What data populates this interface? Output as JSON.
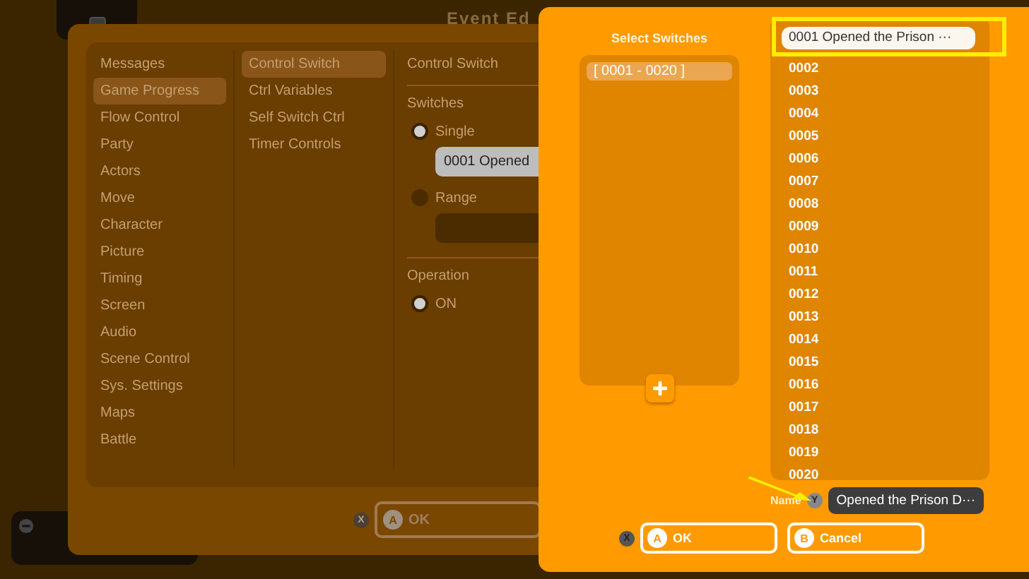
{
  "background": {
    "title": "Event Ed"
  },
  "editor": {
    "categories": [
      {
        "label": "Messages",
        "selected": false
      },
      {
        "label": "Game Progress",
        "selected": true
      },
      {
        "label": "Flow Control",
        "selected": false
      },
      {
        "label": "Party",
        "selected": false
      },
      {
        "label": "Actors",
        "selected": false
      },
      {
        "label": "Move",
        "selected": false
      },
      {
        "label": "Character",
        "selected": false
      },
      {
        "label": "Picture",
        "selected": false
      },
      {
        "label": "Timing",
        "selected": false
      },
      {
        "label": "Screen",
        "selected": false
      },
      {
        "label": "Audio",
        "selected": false
      },
      {
        "label": "Scene Control",
        "selected": false
      },
      {
        "label": "Sys. Settings",
        "selected": false
      },
      {
        "label": "Maps",
        "selected": false
      },
      {
        "label": "Battle",
        "selected": false
      }
    ],
    "commands": [
      {
        "label": "Control Switch",
        "selected": true
      },
      {
        "label": "Ctrl Variables",
        "selected": false
      },
      {
        "label": "Self Switch Ctrl",
        "selected": false
      },
      {
        "label": "Timer Controls",
        "selected": false
      }
    ],
    "detail_title": "Control Switch",
    "switches_label": "Switches",
    "modes": [
      {
        "label": "Single",
        "selected": true,
        "value": "0001 Opened"
      },
      {
        "label": "Range",
        "selected": false
      }
    ],
    "operation_label": "Operation",
    "operations": [
      {
        "label": "ON",
        "selected": true
      }
    ],
    "cancel_key": "X",
    "ok": {
      "key": "A",
      "label": "OK"
    }
  },
  "dialog": {
    "title": "Select Switches",
    "groups": [
      {
        "label": "[ 0001 - 0020 ]",
        "selected": true
      }
    ],
    "switches": [
      {
        "label": "0001 Opened the Prison ···",
        "selected": true
      },
      {
        "label": "0002",
        "selected": false
      },
      {
        "label": "0003",
        "selected": false
      },
      {
        "label": "0004",
        "selected": false
      },
      {
        "label": "0005",
        "selected": false
      },
      {
        "label": "0006",
        "selected": false
      },
      {
        "label": "0007",
        "selected": false
      },
      {
        "label": "0008",
        "selected": false
      },
      {
        "label": "0009",
        "selected": false
      },
      {
        "label": "0010",
        "selected": false
      },
      {
        "label": "0011",
        "selected": false
      },
      {
        "label": "0012",
        "selected": false
      },
      {
        "label": "0013",
        "selected": false
      },
      {
        "label": "0014",
        "selected": false
      },
      {
        "label": "0015",
        "selected": false
      },
      {
        "label": "0016",
        "selected": false
      },
      {
        "label": "0017",
        "selected": false
      },
      {
        "label": "0018",
        "selected": false
      },
      {
        "label": "0019",
        "selected": false
      },
      {
        "label": "0020",
        "selected": false
      }
    ],
    "name_label": "Name",
    "name_key": "Y",
    "name_value": "Opened the Prison D···",
    "cancel_key": "X",
    "buttons": [
      {
        "key": "A",
        "label": "OK"
      },
      {
        "key": "B",
        "label": "Cancel"
      }
    ]
  }
}
